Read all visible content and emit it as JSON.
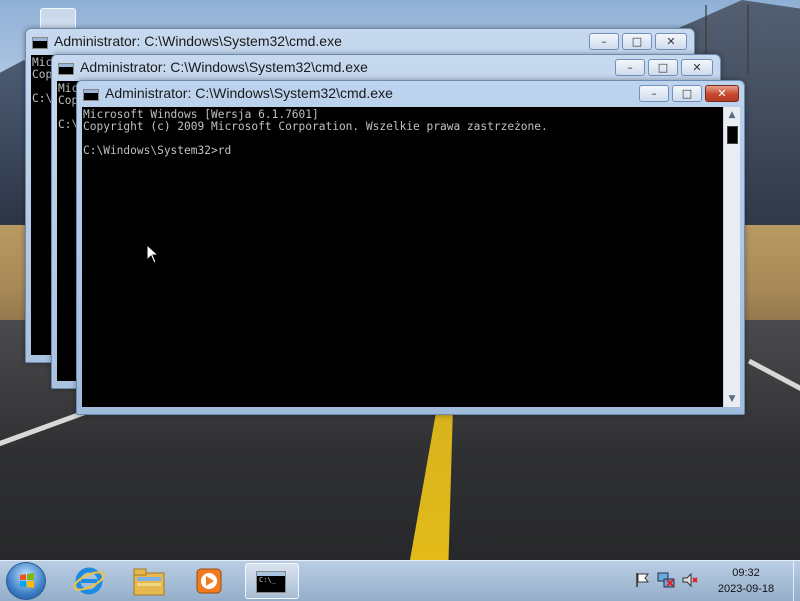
{
  "windows": [
    {
      "title": "Administrator: C:\\Windows\\System32\\cmd.exe",
      "console_text": "Mic\nCop\n\nC:\\"
    },
    {
      "title": "Administrator: C:\\Windows\\System32\\cmd.exe",
      "console_text": "Mic\nCop\n\nC:\\"
    },
    {
      "title": "Administrator: C:\\Windows\\System32\\cmd.exe",
      "console_text": "Microsoft Windows [Wersja 6.1.7601]\nCopyright (c) 2009 Microsoft Corporation. Wszelkie prawa zastrzeżone.\n\nC:\\Windows\\System32>rd"
    }
  ],
  "caption_buttons": {
    "minimize": "–",
    "maximize": "□",
    "close": "✕"
  },
  "taskbar": {
    "start_icon": "windows-logo-icon",
    "pinned": [
      "internet-explorer-icon",
      "explorer-folder-icon",
      "media-player-icon",
      "cmd-icon"
    ],
    "tray": [
      "action-center-flag-icon",
      "network-icon",
      "volume-muted-icon"
    ],
    "time": "09:32",
    "date": "2023-09-18"
  },
  "colors": {
    "console_bg": "#000000",
    "console_text": "#c0c0c0",
    "close_button": "#c7472e",
    "titlebar": "#b9cfe9"
  }
}
